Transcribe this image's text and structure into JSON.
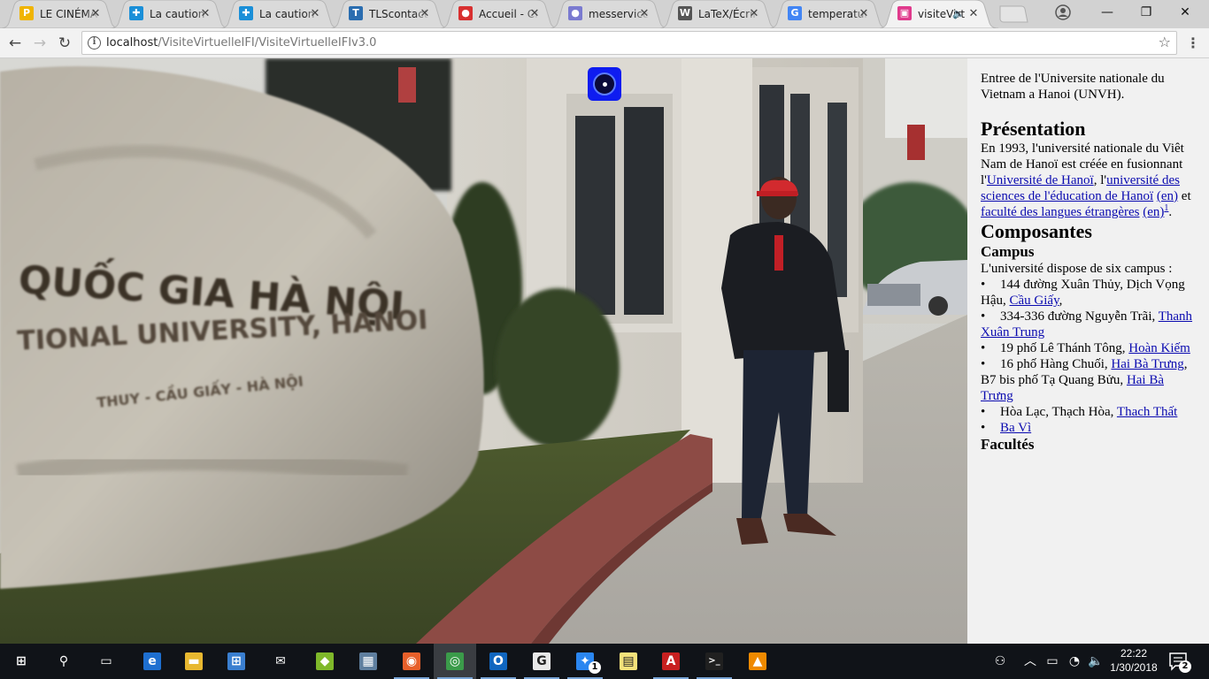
{
  "browser": {
    "tabs": [
      {
        "title": "LE CINÉMA",
        "icon": "prezi-icon",
        "color": "#f0b400",
        "glyph": "P",
        "active": false
      },
      {
        "title": "La caution l",
        "icon": "puzzle-icon",
        "color": "#1a8fd8",
        "glyph": "✚",
        "active": false
      },
      {
        "title": "La caution l",
        "icon": "puzzle-icon",
        "color": "#1a8fd8",
        "glyph": "✚",
        "active": false
      },
      {
        "title": "TLScontact",
        "icon": "tls-icon",
        "color": "#2a6db0",
        "glyph": "T",
        "active": false
      },
      {
        "title": "Accueil - Cr",
        "icon": "red-circle-icon",
        "color": "#d83030",
        "glyph": "●",
        "active": false
      },
      {
        "title": "messervices",
        "icon": "dots-icon",
        "color": "#7a7ad0",
        "glyph": "●",
        "active": false
      },
      {
        "title": "LaTeX/Écrire",
        "icon": "wikibooks-icon",
        "color": "#555555",
        "glyph": "W",
        "active": false
      },
      {
        "title": "temperature",
        "icon": "google-icon",
        "color": "#4285f4",
        "glyph": "G",
        "active": false
      },
      {
        "title": "visiteVirt",
        "icon": "site-icon",
        "color": "#e03a8c",
        "glyph": "▣",
        "active": true
      }
    ],
    "close_glyph": "✕",
    "audio_glyph": "🔈",
    "window": {
      "minimize": "—",
      "maximize": "❐",
      "close": "✕"
    },
    "nav": {
      "back": "←",
      "forward": "→",
      "reload": "↻"
    },
    "url": {
      "host": "localhost",
      "path": "/VisiteVirtuelleIFI/VisiteVirtuelleIFIv3.0"
    },
    "star_glyph": "☆",
    "menu_glyph": "⋮",
    "info_glyph": "i"
  },
  "panel": {
    "intro": "Entree de l'Universite nationale du Vietnam a Hanoi (UNVH).",
    "presentation_heading": "Présentation",
    "presentation": {
      "t1": "En 1993, l'université nationale du Viêt Nam de Hanoï est créée en fusionnant l'",
      "link1": "Université de Hanoï",
      "t2": ", l'",
      "link2": "université des sciences de l'éducation de Hanoï",
      "t3": " ",
      "link3": "(en)",
      "t4": " et ",
      "link4": "faculté des langues étrangères",
      "t5": " ",
      "link5": "(en)",
      "sup": "1",
      "t6": "."
    },
    "composantes_heading": "Composantes",
    "campus_heading": "Campus",
    "campus_intro": "L'université dispose de six campus :",
    "bullet": "•",
    "campuses": [
      {
        "text": "144 đường Xuân Thủy, Dịch Vọng Hậu, ",
        "link": "Cầu Giấy",
        "tail": ","
      },
      {
        "text": "334-336 đường Nguyễn Trãi, ",
        "link": "Thanh Xuân Trung",
        "tail": ""
      },
      {
        "text": "19 phố Lê Thánh Tông, ",
        "link": "Hoàn Kiếm",
        "tail": ""
      },
      {
        "text": "16 phố Hàng Chuối, ",
        "link": "Hai Bà Trưng",
        "tail": ", B7 bis phố Tạ Quang Bửu, ",
        "link2": "Hai Bà Trưng"
      },
      {
        "text": "Hòa Lạc, Thạch Hòa, ",
        "link": "Thach Thất",
        "tail": ""
      },
      {
        "text": "",
        "link": "Ba Vì",
        "tail": ""
      }
    ],
    "facultes_heading": "Facultés"
  },
  "scene": {
    "sign_line1": "QUỐC GIA HÀ NỘI",
    "sign_line2": "TIONAL UNIVERSITY, HANOI",
    "sign_line3": "THUY - CẦU GIẤY - HÀ NỘI"
  },
  "taskbar": {
    "apps": [
      {
        "name": "windows-start-icon",
        "glyph": "⊞",
        "color": "#101318"
      },
      {
        "name": "search-icon",
        "glyph": "⚲",
        "color": "#101318"
      },
      {
        "name": "task-view-icon",
        "glyph": "▭",
        "color": "#101318"
      },
      {
        "name": "edge-icon",
        "glyph": "e",
        "color": "#1e6fd0"
      },
      {
        "name": "file-explorer-icon",
        "glyph": "▬",
        "color": "#e8b830"
      },
      {
        "name": "store-icon",
        "glyph": "⊞",
        "color": "#3a7fd0"
      },
      {
        "name": "mail-icon",
        "glyph": "✉",
        "color": "#101318"
      },
      {
        "name": "bluestacks-icon",
        "glyph": "◆",
        "color": "#7fb82a"
      },
      {
        "name": "photos-icon",
        "glyph": "▦",
        "color": "#5f7f9f"
      },
      {
        "name": "firefox-icon",
        "glyph": "◉",
        "color": "#e8602a"
      },
      {
        "name": "chrome-icon",
        "glyph": "◎",
        "color": "#3b9b4a"
      },
      {
        "name": "outlook-icon",
        "glyph": "O",
        "color": "#1066c0"
      },
      {
        "name": "google-icon",
        "glyph": "G",
        "color": "#e8e8e8"
      },
      {
        "name": "messenger-icon",
        "glyph": "✦",
        "color": "#2a86f0"
      },
      {
        "name": "sticky-notes-icon",
        "glyph": "▤",
        "color": "#f4e27a"
      },
      {
        "name": "acrobat-icon",
        "glyph": "A",
        "color": "#c82020"
      },
      {
        "name": "terminal-icon",
        "glyph": ">_",
        "color": "#202020"
      },
      {
        "name": "vlc-icon",
        "glyph": "▲",
        "color": "#f08a00"
      }
    ],
    "messenger_badge": "1",
    "clock_time": "22:22",
    "clock_date": "1/30/2018",
    "notif_badge": "2",
    "tray_glyphs": {
      "people": "⚇",
      "chevron": "︿",
      "battery": "▭",
      "wifi": "◔",
      "volume": "🔈"
    }
  }
}
